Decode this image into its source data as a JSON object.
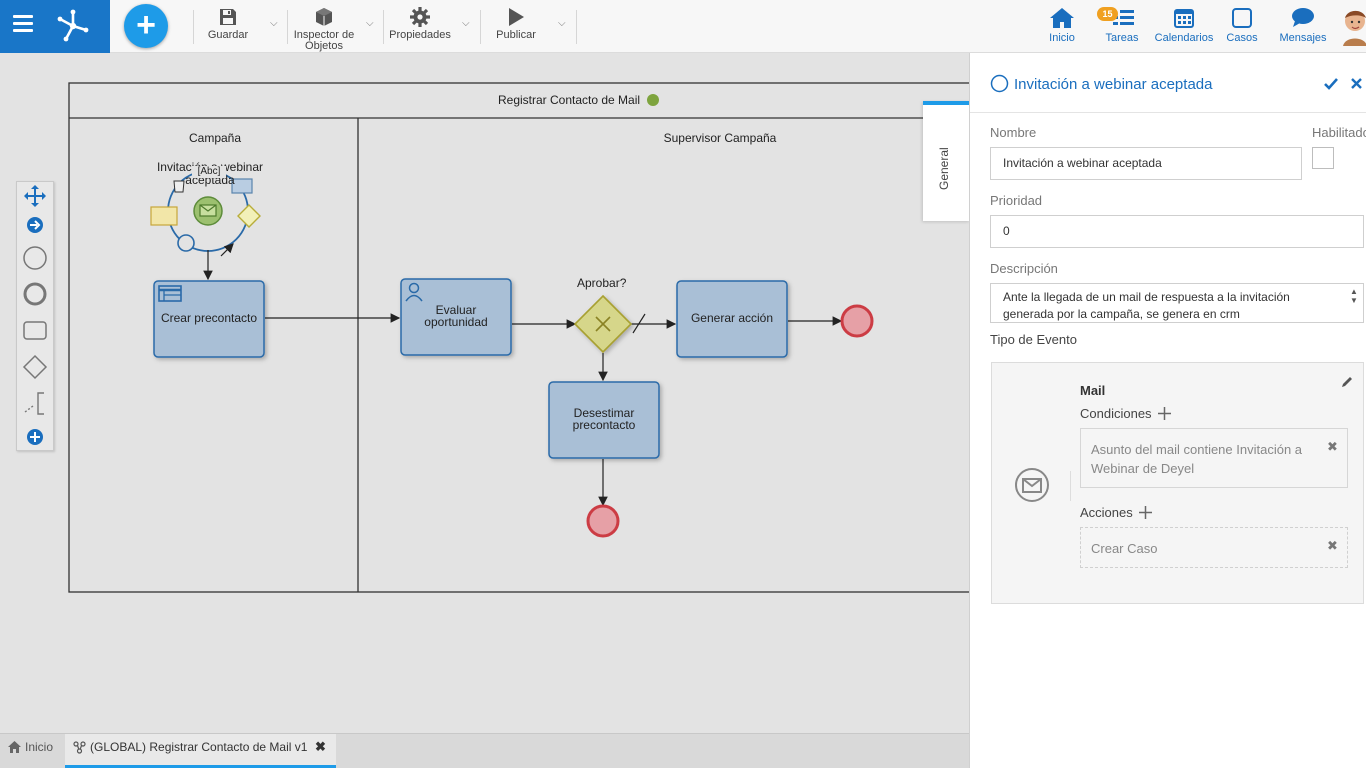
{
  "toolbar": {
    "save": "Guardar",
    "inspector_line1": "Inspector de",
    "inspector_line2": "Objetos",
    "properties": "Propiedades",
    "publish": "Publicar"
  },
  "nav": {
    "home": "Inicio",
    "tasks": "Tareas",
    "tasks_badge": "15",
    "calendars": "Calendarios",
    "cases": "Casos",
    "messages": "Mensajes"
  },
  "diagram": {
    "pool_title": "Registrar Contacto de Mail",
    "lanes": [
      "Campaña",
      "Supervisor Campaña"
    ],
    "start_event_label": "Invitación a webinar aceptada",
    "context_abc": "[Abc]",
    "tasks": {
      "crear": "Crear precontacto",
      "evaluar_line1": "Evaluar",
      "evaluar_line2": "oportunidad",
      "generar": "Generar acción",
      "desestimar_line1": "Desestimar",
      "desestimar_line2": "precontacto"
    },
    "gateway_label": "Aprobar?"
  },
  "panel": {
    "tab_label": "General",
    "title": "Invitación a webinar aceptada",
    "name_label": "Nombre",
    "name_value": "Invitación a webinar aceptada",
    "enabled_label": "Habilitado",
    "priority_label": "Prioridad",
    "priority_value": "0",
    "description_label": "Descripción",
    "description_value": "Ante la llegada de un mail de respuesta a la invitación generada por la campaña, se genera en crm",
    "event_type_label": "Tipo de Evento",
    "event_type": "Mail",
    "conditions_label": "Condiciones",
    "condition_value": "Asunto del mail contiene Invitación a Webinar de Deyel",
    "actions_label": "Acciones",
    "action_value": "Crear Caso"
  },
  "bottom_tabs": {
    "home": "Inicio",
    "process": "(GLOBAL) Registrar Contacto de Mail v1"
  },
  "colors": {
    "brand": "#1976c8",
    "accent": "#1e9be8",
    "task_fill": "#a9bfd6",
    "task_stroke": "#2a6aa8",
    "end_event": "#cc3c44",
    "gateway": "#d6d68a"
  }
}
